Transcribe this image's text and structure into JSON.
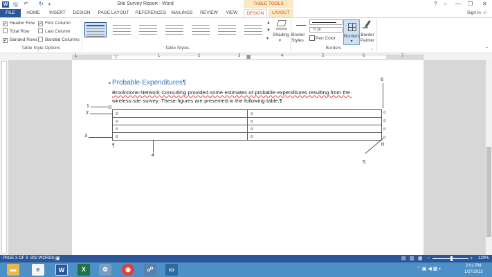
{
  "title_bar": {
    "document_title": "Site Survey Report - Word",
    "context_tab_group": "TABLE TOOLS",
    "app_icon": "W",
    "quick_access_icons": [
      "save-icon",
      "undo-icon",
      "redo-icon",
      "customize-icon"
    ],
    "window_controls": [
      "?",
      "▫",
      "—",
      "▭",
      "✕"
    ]
  },
  "ribbon_tabs": [
    "FILE",
    "HOME",
    "INSERT",
    "DESIGN",
    "PAGE LAYOUT",
    "REFERENCES",
    "MAILINGS",
    "REVIEW",
    "VIEW",
    "DESIGN",
    "LAYOUT"
  ],
  "signin": "Sign in",
  "table_style_options": {
    "items": [
      {
        "label": "Header Row",
        "checked": true
      },
      {
        "label": "First Column",
        "checked": true
      },
      {
        "label": "Total Row",
        "checked": false
      },
      {
        "label": "Last Column",
        "checked": false
      },
      {
        "label": "Banded Rows",
        "checked": true
      },
      {
        "label": "Banded Columns",
        "checked": false
      }
    ],
    "group_label": "Table Style Options"
  },
  "table_styles": {
    "group_label": "Table Styles"
  },
  "shading": {
    "label": "Shading"
  },
  "borders_group": {
    "border_styles": "Border Styles",
    "pen_weight": "½ pt",
    "pen_color": "Pen Color",
    "borders": "Borders",
    "border_painter": "Border Painter",
    "group_label": "Borders"
  },
  "ruler": {
    "numbers": [
      "1",
      "1",
      "2",
      "3",
      "4",
      "5",
      "6",
      "7"
    ]
  },
  "document": {
    "heading": "Probable·Expenditures¶",
    "paragraph_line1": "Brookstone·Network·Consulting·provided·some·estimates·of·probable·expenditures·resulting·from·the·",
    "paragraph_line2": "wireless·site·survey.·These·figures·are·presented·in·the·following·table.¶",
    "table_cells": [
      [
        "¤",
        "¤"
      ],
      [
        "¤",
        "¤"
      ],
      [
        "¤",
        "¤"
      ],
      [
        "¤",
        "¤"
      ]
    ],
    "row_end_marks": [
      "¤",
      "¤",
      "¤",
      "¤"
    ],
    "after_table_mark": "¶",
    "callouts": [
      "1",
      "2",
      "3",
      "4",
      "5",
      "6"
    ]
  },
  "status_bar": {
    "page": "PAGE 3 OF 3",
    "words": "802 WORDS",
    "zoom": "120%"
  },
  "taskbar": {
    "time": "2:01 PM",
    "date": "1/27/2013"
  },
  "colors": {
    "accent": "#2b579a",
    "context_tab": "#c55a11",
    "heading": "#2e74b5"
  }
}
